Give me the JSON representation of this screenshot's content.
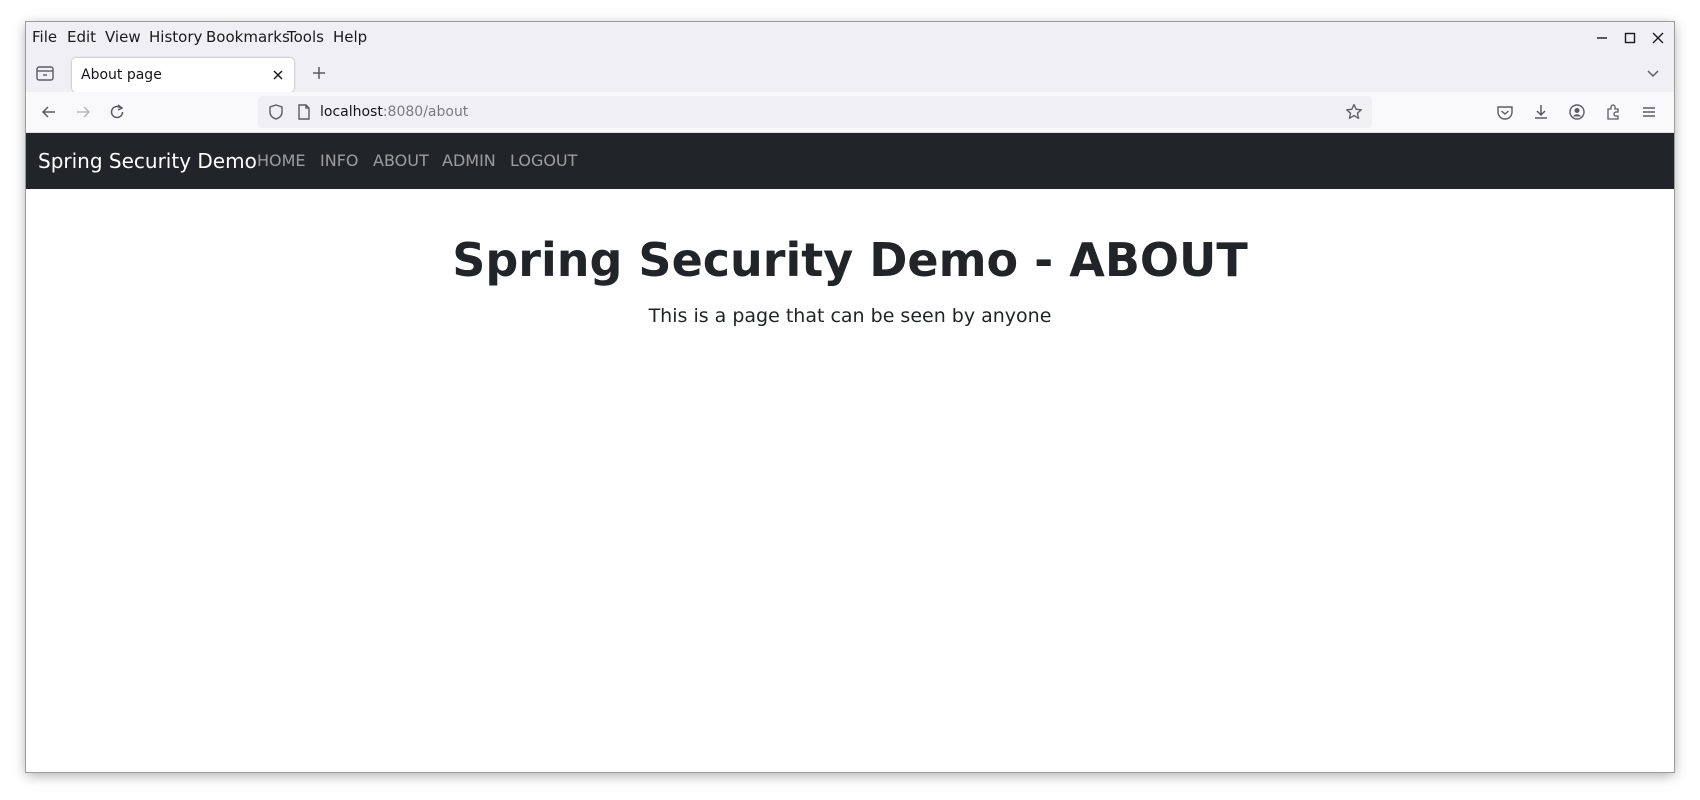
{
  "browser": {
    "menu": [
      "File",
      "Edit",
      "View",
      "History",
      "Bookmarks",
      "Tools",
      "Help"
    ],
    "tab": {
      "title": "About page"
    },
    "url": {
      "host": "localhost",
      "rest": ":8080/about"
    }
  },
  "site": {
    "brand": "Spring Security Demo",
    "nav": [
      "HOME",
      "INFO",
      "ABOUT",
      "ADMIN",
      "LOGOUT"
    ],
    "heading": "Spring Security Demo - ABOUT",
    "subheading": "This is a page that can be seen by anyone"
  },
  "colors": {
    "navbar_bg": "#212529",
    "nav_link": "rgba(255,255,255,0.55)",
    "text": "#212529"
  }
}
